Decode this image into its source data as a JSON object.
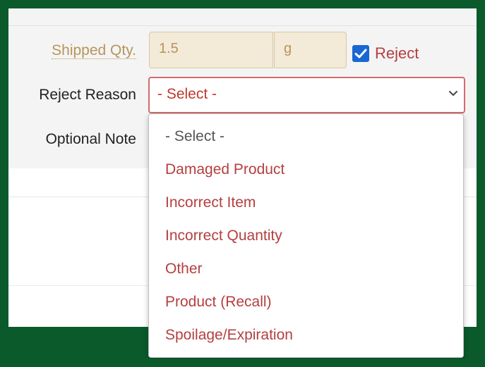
{
  "form": {
    "shipped_qty_label": "Shipped Qty.",
    "shipped_qty_value": "1.5",
    "unit_value": "g",
    "reject_checkbox_label": "Reject",
    "reject_checked": true,
    "reject_reason_label": "Reject Reason",
    "reject_reason_selected": "- Select -",
    "optional_note_label": "Optional Note"
  },
  "dropdown": {
    "options": [
      "- Select -",
      "Damaged Product",
      "Incorrect Item",
      "Incorrect Quantity",
      "Other",
      "Product (Recall)",
      "Spoilage/Expiration"
    ]
  },
  "colors": {
    "frame": "#0a5a2c",
    "accent_red": "#b53f3f",
    "checkbox_blue": "#1967d2",
    "disabled_field": "#f3ead7"
  },
  "icons": {
    "checkbox": "checkmark-icon",
    "select": "chevron-down-icon"
  }
}
